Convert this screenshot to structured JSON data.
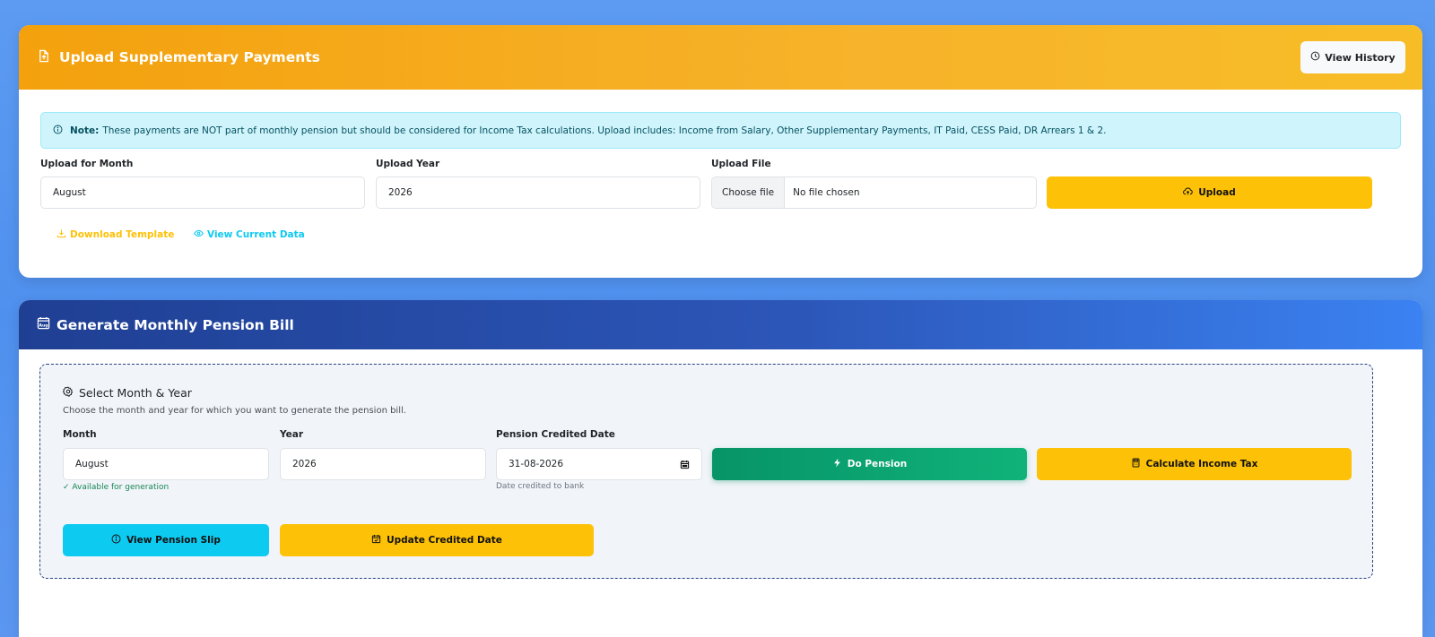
{
  "upload_card": {
    "title": "Upload Supplementary Payments",
    "history_button": "View History",
    "note_label": "Note:",
    "note_text": "These payments are NOT part of monthly pension but should be considered for Income Tax calculations. Upload includes: Income from Salary, Other Supplementary Payments, IT Paid, CESS Paid, DR Arrears 1 & 2.",
    "month_label": "Upload for Month",
    "month_value": "August",
    "year_label": "Upload Year",
    "year_value": "2026",
    "file_label": "Upload File",
    "choose_file": "Choose file",
    "no_file": "No file chosen",
    "upload_button": "Upload",
    "download_template": "Download Template",
    "view_current_data": "View Current Data"
  },
  "bill_card": {
    "title": "Generate Monthly Pension Bill",
    "panel_title": "Select Month & Year",
    "panel_subtitle": "Choose the month and year for which you want to generate the pension bill.",
    "month_label": "Month",
    "month_value": "August",
    "availability": "✓ Available for generation",
    "year_label": "Year",
    "year_value": "2026",
    "credited_label": "Pension Credited Date",
    "credited_value": "31-08-2026",
    "credited_hint": "Date credited to bank",
    "do_pension_button": "Do Pension",
    "calc_tax_button": "Calculate Income Tax",
    "view_slip_button": "View Pension Slip",
    "update_date_button": "Update Credited Date"
  },
  "colors": {
    "upload_header": "#f4a10d",
    "bill_header": "#1f3f93",
    "yellow": "#fdc107",
    "green": "#079467",
    "cyan": "#0dcaf0",
    "link_yellow": "#fdc107",
    "link_cyan": "#0dcaf0",
    "success_text": "#198754"
  },
  "icons": {
    "upload_header": "file-upload-icon",
    "history": "clock-history-icon",
    "note": "info-circle-icon",
    "upload": "cloud-upload-icon",
    "download": "download-icon",
    "view": "eye-icon",
    "bill_header": "calendar-icon",
    "settings": "gear-icon",
    "do_pension": "lightning-icon",
    "calculator": "calculator-icon",
    "slip": "info-circle-icon",
    "calendar_check": "calendar-check-icon"
  }
}
